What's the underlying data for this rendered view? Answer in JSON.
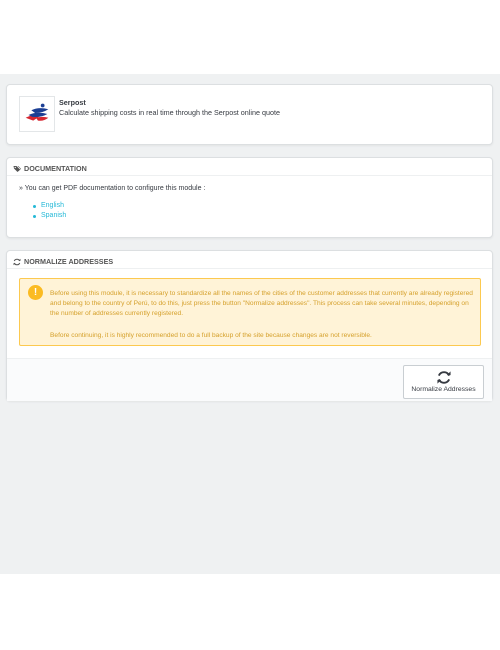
{
  "module": {
    "name": "Serpost",
    "description": "Calculate shipping costs in real time through the Serpost online quote",
    "logo_icon": "serpost-logo-icon"
  },
  "documentation": {
    "title": "DOCUMENTATION",
    "icon": "tags-icon",
    "intro": "» You can get PDF documentation to configure this module :",
    "links": [
      {
        "label": "English"
      },
      {
        "label": "Spanish"
      }
    ]
  },
  "normalize": {
    "title": "NORMALIZE ADDRESSES",
    "icon": "refresh-icon",
    "alert": {
      "icon": "warning-icon",
      "paragraph1": "Before using this module, it is necessary to standardize all the names of the cities of the customer addresses that currently are already registered and belong to the country of Perú, to do this, just press the button \"Normalize addresses\". This process can take several minutes, depending on the number of addresses currently registered.",
      "paragraph2": "Before continuing, it is highly recommended to do a full backup of the site because changes are not reversible."
    },
    "button_label": "Normalize Addresses"
  },
  "colors": {
    "link": "#25b9d7",
    "alert_bg": "#fff3d7",
    "alert_border": "#fcc94f",
    "alert_text": "#d5a02b",
    "page_bg": "#eff1f2"
  }
}
